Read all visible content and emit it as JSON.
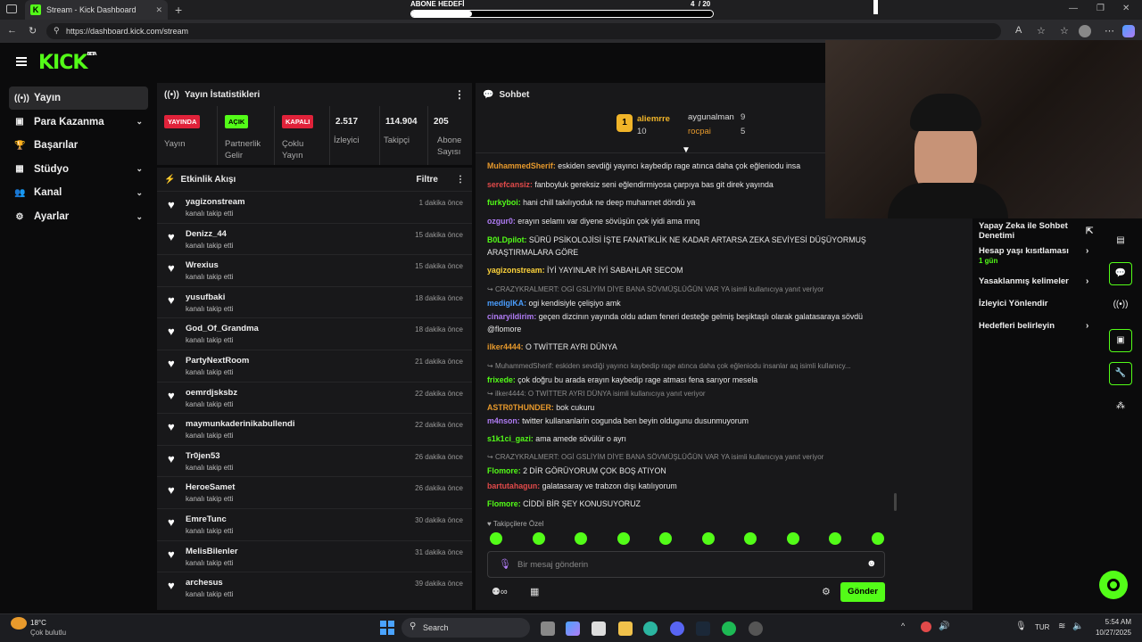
{
  "browser": {
    "tab_title": "Stream - Kick Dashboard",
    "url": "https://dashboard.kick.com/stream"
  },
  "goal": {
    "label": "ABONE HEDEFİ",
    "current": "4",
    "sep_total": "/ 20",
    "progress": 0.2
  },
  "brand": {
    "logo": "KICK",
    "badge": "BETA",
    "accent": "#53fc18"
  },
  "nav": [
    {
      "label": "Yayın",
      "icon": "broadcast-icon",
      "chev": false
    },
    {
      "label": "Para Kazanma",
      "icon": "money-icon",
      "chev": true
    },
    {
      "label": "Başarılar",
      "icon": "trophy-icon",
      "chev": false
    },
    {
      "label": "Stüdyo",
      "icon": "studio-icon",
      "chev": true
    },
    {
      "label": "Kanal",
      "icon": "channel-icon",
      "chev": true
    },
    {
      "label": "Ayarlar",
      "icon": "gear-icon",
      "chev": true
    }
  ],
  "stats": {
    "title": "Yayın İstatistikleri",
    "items": [
      {
        "badge": "YAYINDA",
        "label": "Yayın"
      },
      {
        "badge": "AÇIK",
        "label": "Partnerlik Gelir"
      },
      {
        "badge": "KAPALI",
        "label": "Çoklu Yayın"
      },
      {
        "value": "2.517",
        "label": "İzleyici"
      },
      {
        "value": "114.904",
        "label": "Takipçi"
      },
      {
        "value": "205",
        "label": "Abone Sayısı"
      }
    ]
  },
  "activity": {
    "title": "Etkinlik Akışı",
    "filter": "Filtre",
    "items": [
      {
        "name": "yagizonstream",
        "sub": "kanalı takip etti",
        "time": "1 dakika önce"
      },
      {
        "name": "Denizz_44",
        "sub": "kanalı takip etti",
        "time": "15 dakika önce"
      },
      {
        "name": "Wrexius",
        "sub": "kanalı takip etti",
        "time": "15 dakika önce"
      },
      {
        "name": "yusufbaki",
        "sub": "kanalı takip etti",
        "time": "18 dakika önce"
      },
      {
        "name": "God_Of_Grandma",
        "sub": "kanalı takip etti",
        "time": "18 dakika önce"
      },
      {
        "name": "PartyNextRoom",
        "sub": "kanalı takip etti",
        "time": "21 dakika önce"
      },
      {
        "name": "oemrdjsksbz",
        "sub": "kanalı takip etti",
        "time": "22 dakika önce"
      },
      {
        "name": "maymunkaderinikabullendi",
        "sub": "kanalı takip etti",
        "time": "22 dakika önce"
      },
      {
        "name": "Tr0jen53",
        "sub": "kanalı takip etti",
        "time": "26 dakika önce"
      },
      {
        "name": "HeroeSamet",
        "sub": "kanalı takip etti",
        "time": "26 dakika önce"
      },
      {
        "name": "EmreTunc",
        "sub": "kanalı takip etti",
        "time": "30 dakika önce"
      },
      {
        "name": "MelisBilenler",
        "sub": "kanalı takip etti",
        "time": "31 dakika önce"
      },
      {
        "name": "archesus",
        "sub": "kanalı takip etti",
        "time": "39 dakika önce"
      }
    ]
  },
  "chat": {
    "title": "Sohbet",
    "leaderboard": [
      {
        "rank": "1",
        "name": "aliemrre",
        "count": "10"
      },
      {
        "name": "aygunalman",
        "count": "9"
      },
      {
        "name": "rocpai",
        "count": "5"
      }
    ],
    "messages": [
      {
        "user": "MuhammedSherif",
        "color": "#e89a2c",
        "text": "eskiden sevdiği yayıncı kaybedip rage atınca daha çok eğleniodu insa"
      },
      {
        "user": "serefcansiz",
        "color": "#e24a4a",
        "text": "fanboyluk gereksiz seni eğlendirmiyosa çarpıya bas git direk yayında"
      },
      {
        "user": "furkyboi",
        "color": "#53fc18",
        "text": "hani chill takılıyoduk ne deep muhannet döndü ya"
      },
      {
        "user": "ozgur0",
        "color": "#b07cf5",
        "text": "erayın selamı var diyene sövüşün çok iyidi ama mnq"
      },
      {
        "user": "B0LDpilot",
        "color": "#53fc18",
        "text": "SÜRÜ PSİKOLOJİSİ İŞTE FANATİKLİK NE KADAR ARTARSA ZEKA SEVİYESİ DÜŞÜYORMUŞ ARAŞTIRMALARA GÖRE"
      },
      {
        "user": "yagizonstream",
        "color": "#ffd43b",
        "text": "İYİ YAYINLAR İYİ SABAHLAR SECOM"
      },
      {
        "reply": "CRAZYKRALMERT: OGİ GSLİYİM DİYE BANA SÖVMÜŞLÜĞÜN VAR YA isimli kullanıcıya yanıt veriyor",
        "user": "medigIKA",
        "color": "#4a9eff",
        "text": "ogi kendisiyle çelişiyo amk"
      },
      {
        "user": "cinaryildirim",
        "color": "#b07cf5",
        "text": "geçen dizcinın yayında oldu adam feneri desteğe gelmiş beşiktaşlı olarak galatasaraya sövdü @flomore"
      },
      {
        "user": "ilker4444",
        "color": "#e89a2c",
        "text": "O TWİTTER AYRI DÜNYA"
      },
      {
        "reply": "MuhammedSherif: eskiden sevdiği yayıncı kaybedip rage atınca daha çok eğleniodu insanlar aq isimli kullanıcy...",
        "user": "frixede",
        "color": "#53fc18",
        "text": "çok doğru bu arada erayın kaybedip rage atması fena sarıyor mesela"
      },
      {
        "reply": "ilker4444: O TWİTTER AYRI DÜNYA isimli kullanıcıya yanıt veriyor",
        "user": "ASTR0THUNDER",
        "color": "#e89a2c",
        "text": "bok cukuru"
      },
      {
        "user": "m4nson",
        "color": "#b07cf5",
        "text": "twitter kullananlarin cogunda ben beyin oldugunu dusunmuyorum"
      },
      {
        "user": "s1k1ci_gazi",
        "color": "#53fc18",
        "text": "ama amede sövülür o ayrı"
      },
      {
        "reply": "CRAZYKRALMERT: OGİ GSLİYİM DİYE BANA SÖVMÜŞLÜĞÜN VAR YA isimli kullanıcıya yanıt veriyor",
        "user": "Flomore",
        "color": "#53fc18",
        "text": "2 DİR GÖRÜYORUM ÇOK BOŞ ATIYON"
      },
      {
        "user": "bartutahagun",
        "color": "#e24a4a",
        "text": "galatasaray ve trabzon dışı katılıyorum"
      },
      {
        "user": "Flomore",
        "color": "#53fc18",
        "text": "CİDDİ BİR ŞEY KONUSUYORUZ"
      }
    ],
    "followers_only": "Takipçilere Özel",
    "input_placeholder": "Bir mesaj gönderin",
    "send": "Gönder"
  },
  "right_panel": {
    "items": [
      {
        "label": "Yapay Zeka ile Sohbet Denetimi"
      },
      {
        "label": "Hesap yaşı kısıtlaması",
        "sub": "1 gün"
      },
      {
        "label": "Yasaklanmış kelimeler"
      },
      {
        "label": "İzleyici Yönlendir"
      },
      {
        "label": "Hedefleri belirleyin"
      }
    ]
  },
  "taskbar": {
    "weather_temp": "18°C",
    "weather_desc": "Çok bulutlu",
    "search": "Search",
    "lang": "TUR",
    "time": "5:54 AM",
    "date": "10/27/2025"
  }
}
